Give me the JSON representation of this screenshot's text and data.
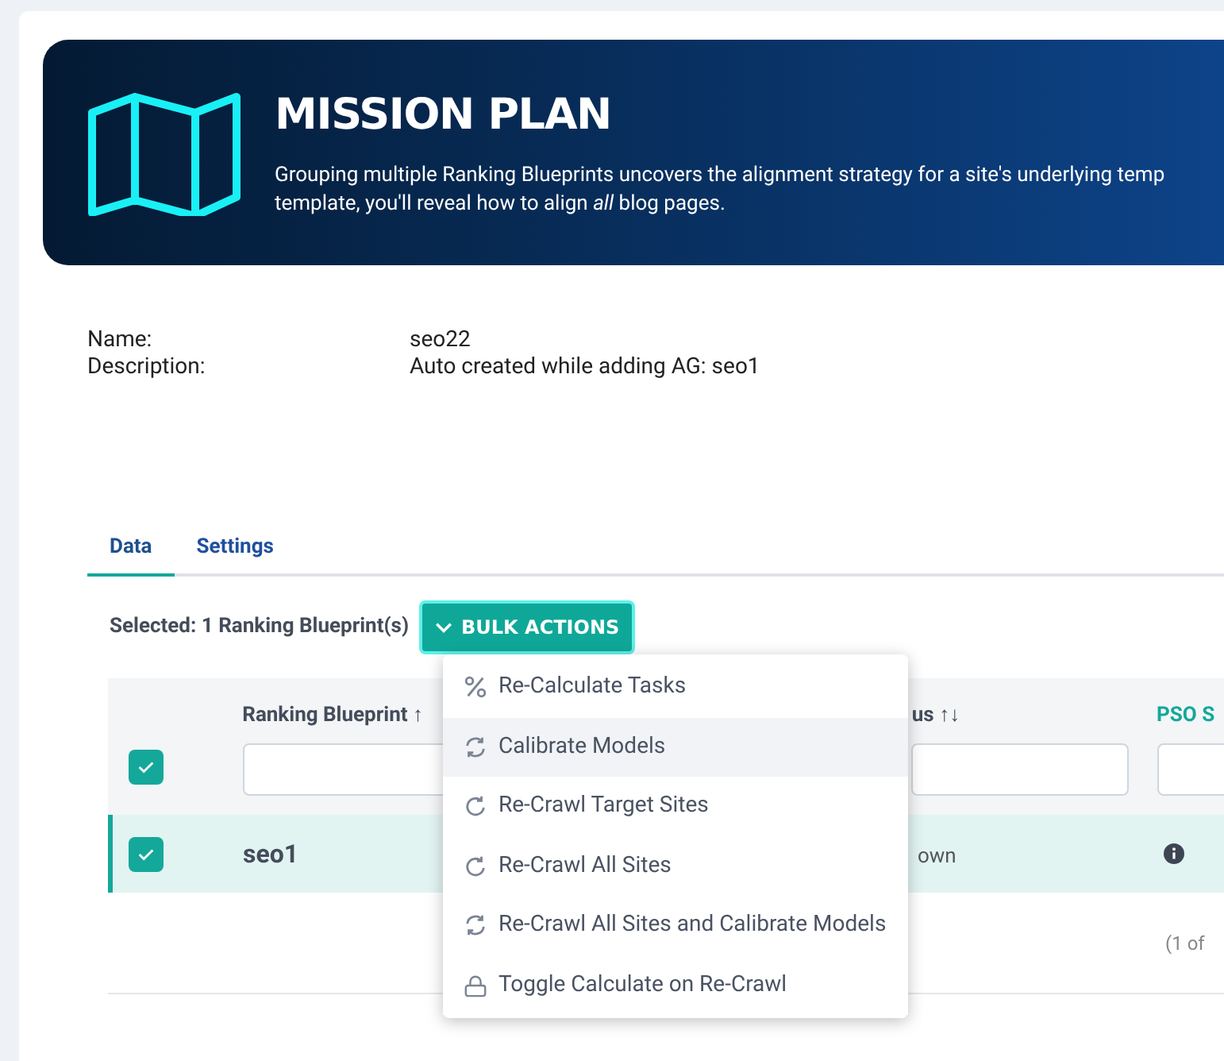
{
  "banner": {
    "title": "MISSION PLAN",
    "lines": [
      "Grouping multiple Ranking Blueprints uncovers the alignment strategy for a site's underlying temp",
      "template, you'll reveal how to align *all* blog pages."
    ]
  },
  "details": [
    {
      "label": "Name:",
      "value": "seo22"
    },
    {
      "label": "Description:",
      "value": "Auto created while adding AG: seo1"
    }
  ],
  "tabs": [
    {
      "label": "Data",
      "selected": true
    },
    {
      "label": "Settings",
      "selected": false
    }
  ],
  "selection": {
    "text": "Selected: 1 Ranking Blueprint(s)",
    "button": "BULK ACTIONS"
  },
  "table": {
    "all_checked": true,
    "columns": [
      {
        "label": "Ranking Blueprint ↑",
        "accent": false
      },
      {
        "label": "us ↑↓",
        "accent": false
      },
      {
        "label": "PSO S",
        "accent": true
      }
    ],
    "rows": [
      {
        "checked": true,
        "selected": true,
        "cells": [
          "seo1",
          "own"
        ],
        "info": true
      }
    ],
    "paginator": "(1 of"
  },
  "menu": [
    {
      "kind": "percent",
      "label": "Re-Calculate Tasks",
      "highlighted": false
    },
    {
      "kind": "sync",
      "label": "Calibrate Models",
      "highlighted": true
    },
    {
      "kind": "redo",
      "label": "Re-Crawl Target Sites",
      "highlighted": false
    },
    {
      "kind": "redo",
      "label": "Re-Crawl All Sites",
      "highlighted": false
    },
    {
      "kind": "sync",
      "label": "Re-Crawl All Sites and Calibrate Models",
      "highlighted": false
    },
    {
      "kind": "lock",
      "label": "Toggle Calculate on Re-Crawl",
      "highlighted": false
    }
  ]
}
